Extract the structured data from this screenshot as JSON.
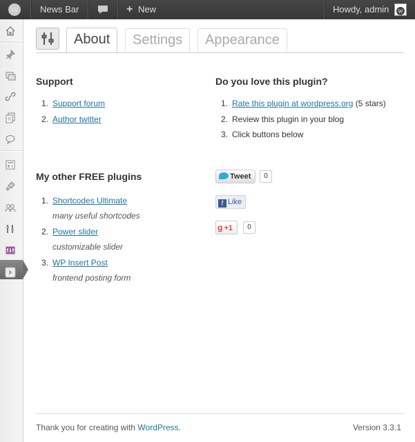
{
  "admin_bar": {
    "site_name": "News Bar",
    "new_label": "New",
    "howdy": "Howdy, admin"
  },
  "sidebar": {
    "items": [
      "dashboard-icon",
      "posts-icon",
      "media-icon",
      "links-icon",
      "pages-icon",
      "comments-icon",
      "appearance-icon",
      "plugins-icon",
      "users-icon",
      "tools-icon",
      "settings-icon",
      "collapse-icon"
    ]
  },
  "tabs": [
    {
      "label": "About",
      "active": true
    },
    {
      "label": "Settings",
      "active": false
    },
    {
      "label": "Appearance",
      "active": false
    }
  ],
  "support": {
    "heading": "Support",
    "items": [
      {
        "num": "1.",
        "label": "Support forum"
      },
      {
        "num": "2.",
        "label": "Author twitter"
      }
    ]
  },
  "love": {
    "heading": "Do you love this plugin?",
    "items": [
      {
        "num": "1.",
        "link": "Rate this plugin at wordpress.org",
        "suffix": " (5 stars)"
      },
      {
        "num": "2.",
        "text": "Review this plugin in your blog"
      },
      {
        "num": "3.",
        "text": "Click buttons below"
      }
    ]
  },
  "other_plugins": {
    "heading": "My other FREE plugins",
    "items": [
      {
        "num": "1.",
        "label": "Shortcodes Ultimate",
        "desc": "many useful shortcodes"
      },
      {
        "num": "2.",
        "label": "Power slider",
        "desc": "customizable slider"
      },
      {
        "num": "3.",
        "label": "WP Insert Post",
        "desc": "frontend posting form"
      }
    ]
  },
  "share": {
    "tweet_label": "Tweet",
    "tweet_count": "0",
    "like_label": "Like",
    "gplus_label": "+1",
    "gplus_count": "0"
  },
  "footer": {
    "thanks_prefix": "Thank you for creating with ",
    "thanks_link": "WordPress",
    "thanks_suffix": ".",
    "version": "Version 3.3.1"
  }
}
